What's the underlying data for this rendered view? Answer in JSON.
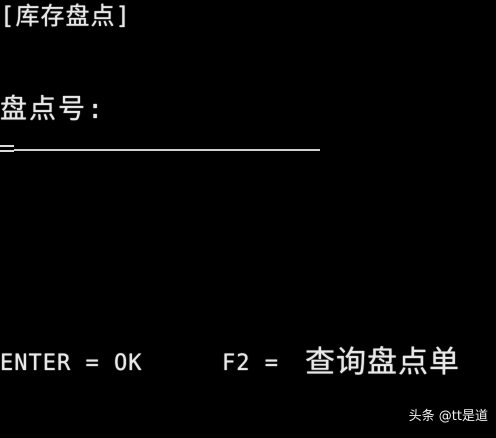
{
  "screen": {
    "title": "[库存盘点]",
    "field_label": "盘点号:",
    "input_value": ""
  },
  "footer": {
    "enter_hint": "ENTER = OK",
    "f2_key": "F2 =",
    "f2_action": "查询盘点单"
  },
  "watermark": {
    "text": "头条 @tt是道"
  },
  "colors": {
    "background": "#000000",
    "foreground": "#e8e8e8"
  }
}
